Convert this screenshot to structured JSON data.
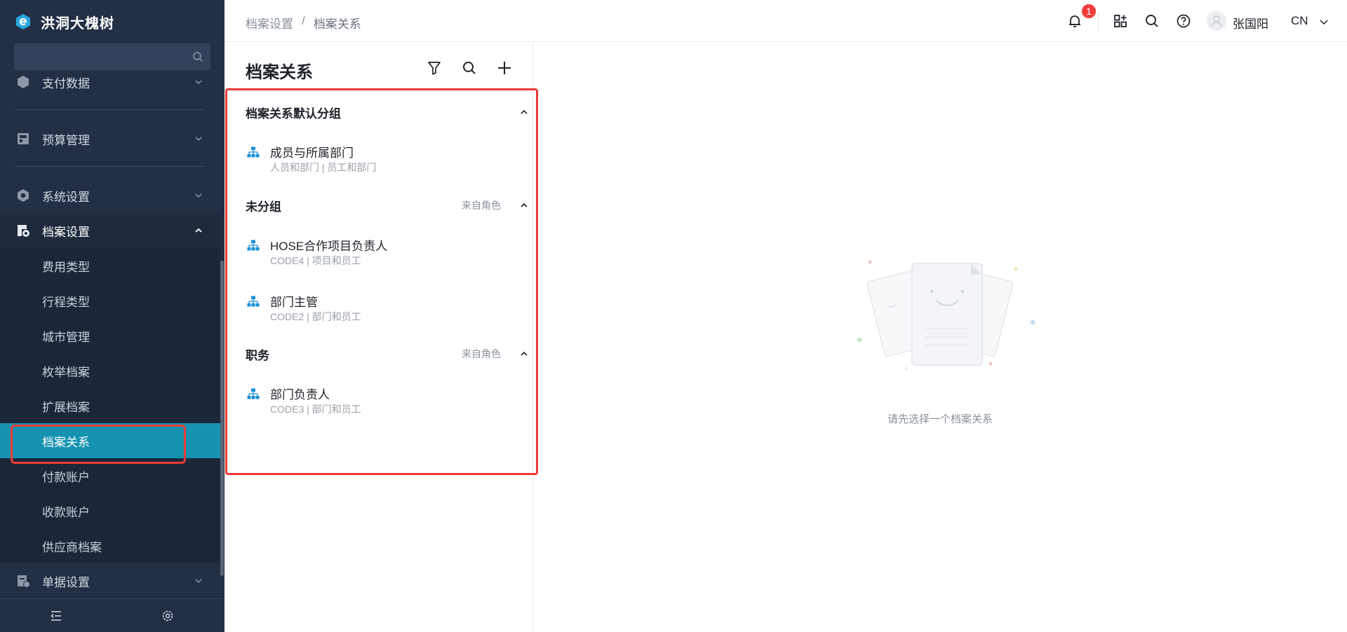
{
  "brand": {
    "name": "洪洞大槐树"
  },
  "sidebar": {
    "search_placeholder": "",
    "partial_item": "支付数据",
    "items": [
      {
        "label": "预算管理",
        "icon": "budget-icon"
      },
      {
        "label": "系统设置",
        "icon": "hexagon-gear-icon"
      },
      {
        "label": "档案设置",
        "icon": "archive-settings-icon",
        "expanded": true
      }
    ],
    "sub_items": [
      "费用类型",
      "行程类型",
      "城市管理",
      "枚举档案",
      "扩展档案",
      "档案关系",
      "付款账户",
      "收款账户",
      "供应商档案"
    ],
    "active_sub": "档案关系",
    "after_item": {
      "label": "单据设置",
      "icon": "form-settings-icon"
    }
  },
  "header": {
    "breadcrumb": [
      "档案设置",
      "档案关系"
    ],
    "breadcrumb_sep": "/",
    "notification_count": "1",
    "user_name": "张国阳",
    "language": "CN"
  },
  "panel": {
    "title": "档案关系",
    "groups": [
      {
        "name": "档案关系默认分组",
        "source": "",
        "items": [
          {
            "name": "成员与所属部门",
            "desc": "人员和部门 | 员工和部门"
          }
        ]
      },
      {
        "name": "未分组",
        "source": "来自角色",
        "items": [
          {
            "name": "HOSE合作项目负责人",
            "desc": "CODE4 | 项目和员工"
          },
          {
            "name": "部门主管",
            "desc": "CODE2 | 部门和员工"
          }
        ]
      },
      {
        "name": "职务",
        "source": "来自角色",
        "items": [
          {
            "name": "部门负责人",
            "desc": "CODE3 | 部门和员工"
          }
        ]
      }
    ]
  },
  "empty_state": {
    "text": "请先选择一个档案关系"
  },
  "colors": {
    "sidebar_bg": "#222f45",
    "active": "#1592b0",
    "highlight": "#ec3a36",
    "badge": "#f23c3c",
    "link_icon": "#1a8fd8"
  }
}
